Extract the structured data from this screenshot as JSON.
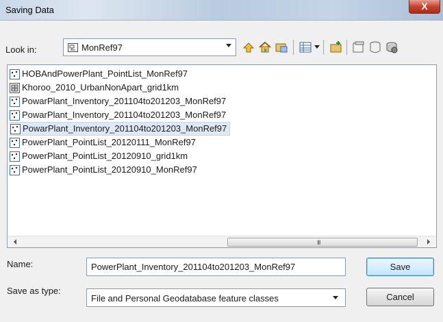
{
  "window": {
    "title": "Saving Data",
    "close_glyph": "X"
  },
  "lookin": {
    "label": "Look in:",
    "value": "MonRef97",
    "icon": "folder-network-icon"
  },
  "toolbar": [
    {
      "name": "up-one-level-icon"
    },
    {
      "name": "home-icon"
    },
    {
      "name": "connect-folder-icon"
    },
    {
      "name": "view-menu-icon"
    },
    {
      "name": "new-folder-icon"
    },
    {
      "name": "catalog-icon"
    },
    {
      "name": "geodatabase-icon"
    },
    {
      "name": "options-icon"
    }
  ],
  "files": [
    {
      "label": "HOBAndPowerPlant_PointList_MonRef97",
      "icon": "point-feature-class-icon",
      "selected": false
    },
    {
      "label": "Khoroo_2010_UrbanNonApart_grid1km",
      "icon": "polygon-feature-class-icon",
      "selected": false
    },
    {
      "label": "PowarPlant_Inventory_201104to201203_MonRef97",
      "icon": "point-feature-class-icon",
      "selected": false
    },
    {
      "label": "PowarPlant_Inventory_201104to201203_MonRef97",
      "icon": "point-feature-class-icon",
      "selected": false
    },
    {
      "label": "PowarPlant_Inventory_201104to201203_MonRef97",
      "icon": "point-feature-class-icon",
      "selected": true
    },
    {
      "label": "PowerPlant_PointList_20120111_MonRef97",
      "icon": "point-feature-class-icon",
      "selected": false
    },
    {
      "label": "PowerPlant_PointList_20120910_grid1km",
      "icon": "point-feature-class-icon",
      "selected": false
    },
    {
      "label": "PowerPlant_PointList_20120910_MonRef97",
      "icon": "point-feature-class-icon",
      "selected": false
    }
  ],
  "scrollbar": {
    "grip": "III"
  },
  "name": {
    "label": "Name:",
    "value": "PowerPlant_Inventory_201104to201203_MonRef97"
  },
  "save_type": {
    "label": "Save as type:",
    "value": "File and Personal Geodatabase feature classes"
  },
  "buttons": {
    "save": "Save",
    "cancel": "Cancel"
  }
}
